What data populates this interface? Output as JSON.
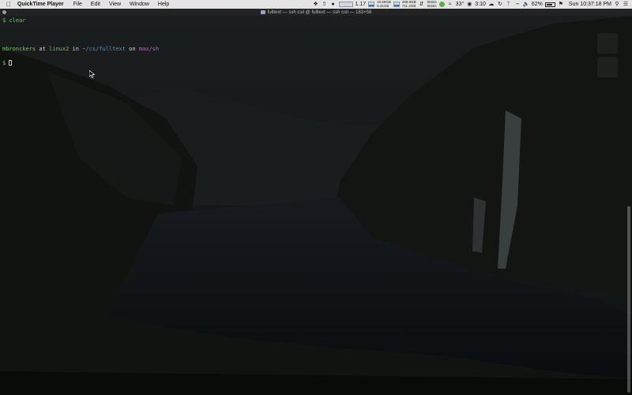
{
  "menubar": {
    "app_name": "QuickTime Player",
    "menus": [
      "File",
      "Edit",
      "View",
      "Window",
      "Help"
    ],
    "load_avg": "1.17",
    "memory": [
      "10.69GB",
      "5.31GB"
    ],
    "disk": [
      "288.9GB",
      "711.2GB"
    ],
    "network": [
      "0KB/s",
      "0KB/s"
    ],
    "temperature": "33°",
    "timer": "3:10",
    "battery": "62%",
    "clock": "Sun 10:37:18 PM"
  },
  "terminal": {
    "title": "fulltext — ssh csil @ fulltext — ssh csil — 183×58",
    "line1_prompt": "$ ",
    "line1_cmd": "clear",
    "line2_user": "mbronckers",
    "line2_at": " at ",
    "line2_host": "linux2",
    "line2_in": " in ",
    "line2_path": "~/cs/fulltext",
    "line2_on": " on ",
    "line2_branch": "max/sh",
    "line3_prompt": "$ "
  },
  "colors": {
    "prompt_green": "#6fc64d",
    "path_blue": "#4f94c9",
    "branch_magenta": "#c161d6",
    "menubar_bg": "#e4e4e4"
  }
}
